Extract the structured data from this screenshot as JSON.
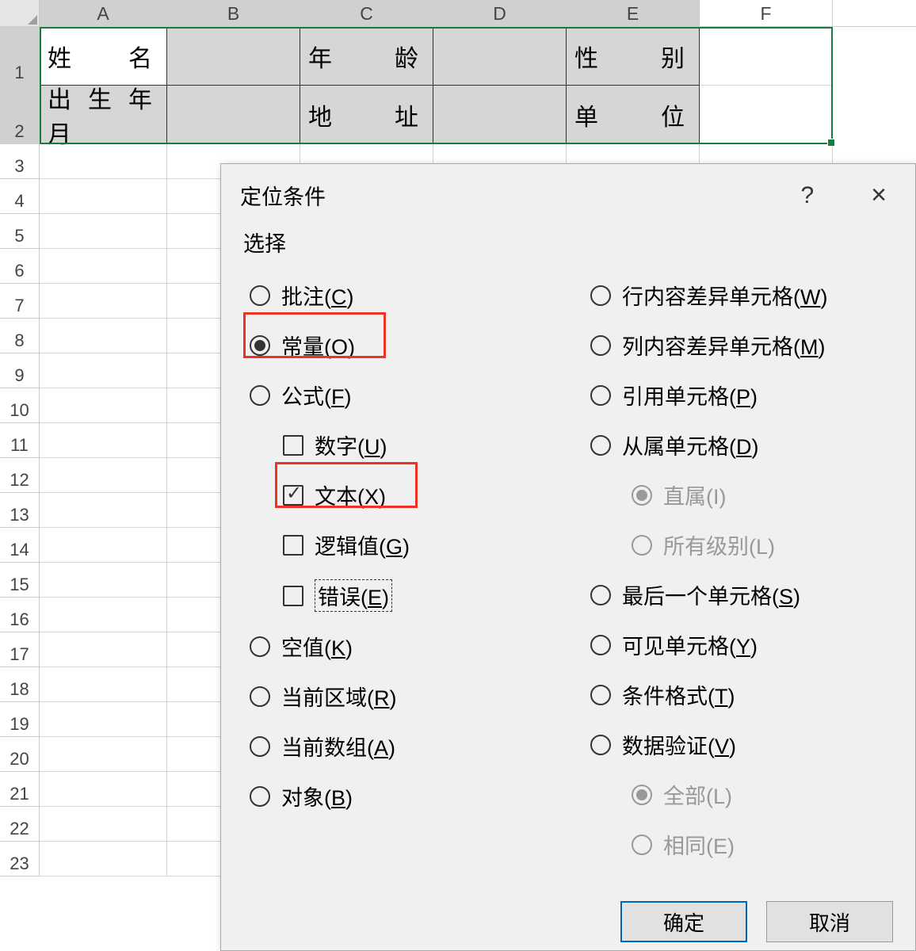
{
  "columns": [
    "A",
    "B",
    "C",
    "D",
    "E",
    "F"
  ],
  "rows": [
    "1",
    "2",
    "3",
    "4",
    "5",
    "6",
    "7",
    "8",
    "9",
    "10",
    "11",
    "12",
    "13",
    "14",
    "15",
    "16",
    "17",
    "18",
    "19",
    "20",
    "21",
    "22",
    "23"
  ],
  "cells": {
    "r1": {
      "A": "姓名",
      "C": "年龄",
      "E": "性别"
    },
    "r2": {
      "A": "出生年月",
      "C": "地址",
      "E": "单位"
    }
  },
  "dialog": {
    "title": "定位条件",
    "help": "?",
    "close": "×",
    "select_label": "选择",
    "left": {
      "comments": {
        "label": "批注(",
        "key": "C",
        "tail": ")"
      },
      "constants": {
        "label": "常量(",
        "key": "O",
        "tail": ")"
      },
      "formulas": {
        "label": "公式(",
        "key": "F",
        "tail": ")"
      },
      "numbers": {
        "label": "数字(",
        "key": "U",
        "tail": ")"
      },
      "text": {
        "label": "文本(",
        "key": "X",
        "tail": ")"
      },
      "logical": {
        "label": "逻辑值(",
        "key": "G",
        "tail": ")"
      },
      "errors": {
        "label": "错误(",
        "key": "E",
        "tail": ")"
      },
      "blanks": {
        "label": "空值(",
        "key": "K",
        "tail": ")"
      },
      "region": {
        "label": "当前区域(",
        "key": "R",
        "tail": ")"
      },
      "array": {
        "label": "当前数组(",
        "key": "A",
        "tail": ")"
      },
      "objects": {
        "label": "对象(",
        "key": "B",
        "tail": ")"
      }
    },
    "right": {
      "rowdiff": {
        "label": "行内容差异单元格(",
        "key": "W",
        "tail": ")"
      },
      "coldiff": {
        "label": "列内容差异单元格(",
        "key": "M",
        "tail": ")"
      },
      "precedents": {
        "label": "引用单元格(",
        "key": "P",
        "tail": ")"
      },
      "dependents": {
        "label": "从属单元格(",
        "key": "D",
        "tail": ")"
      },
      "direct": {
        "label": "直属(I)"
      },
      "alllevels": {
        "label": "所有级别(L)"
      },
      "lastcell": {
        "label": "最后一个单元格(",
        "key": "S",
        "tail": ")"
      },
      "visible": {
        "label": "可见单元格(",
        "key": "Y",
        "tail": ")"
      },
      "condfmt": {
        "label": "条件格式(",
        "key": "T",
        "tail": ")"
      },
      "datavalid": {
        "label": "数据验证(",
        "key": "V",
        "tail": ")"
      },
      "all": {
        "label": "全部(L)"
      },
      "same": {
        "label": "相同(E)"
      }
    },
    "ok": "确定",
    "cancel": "取消"
  }
}
